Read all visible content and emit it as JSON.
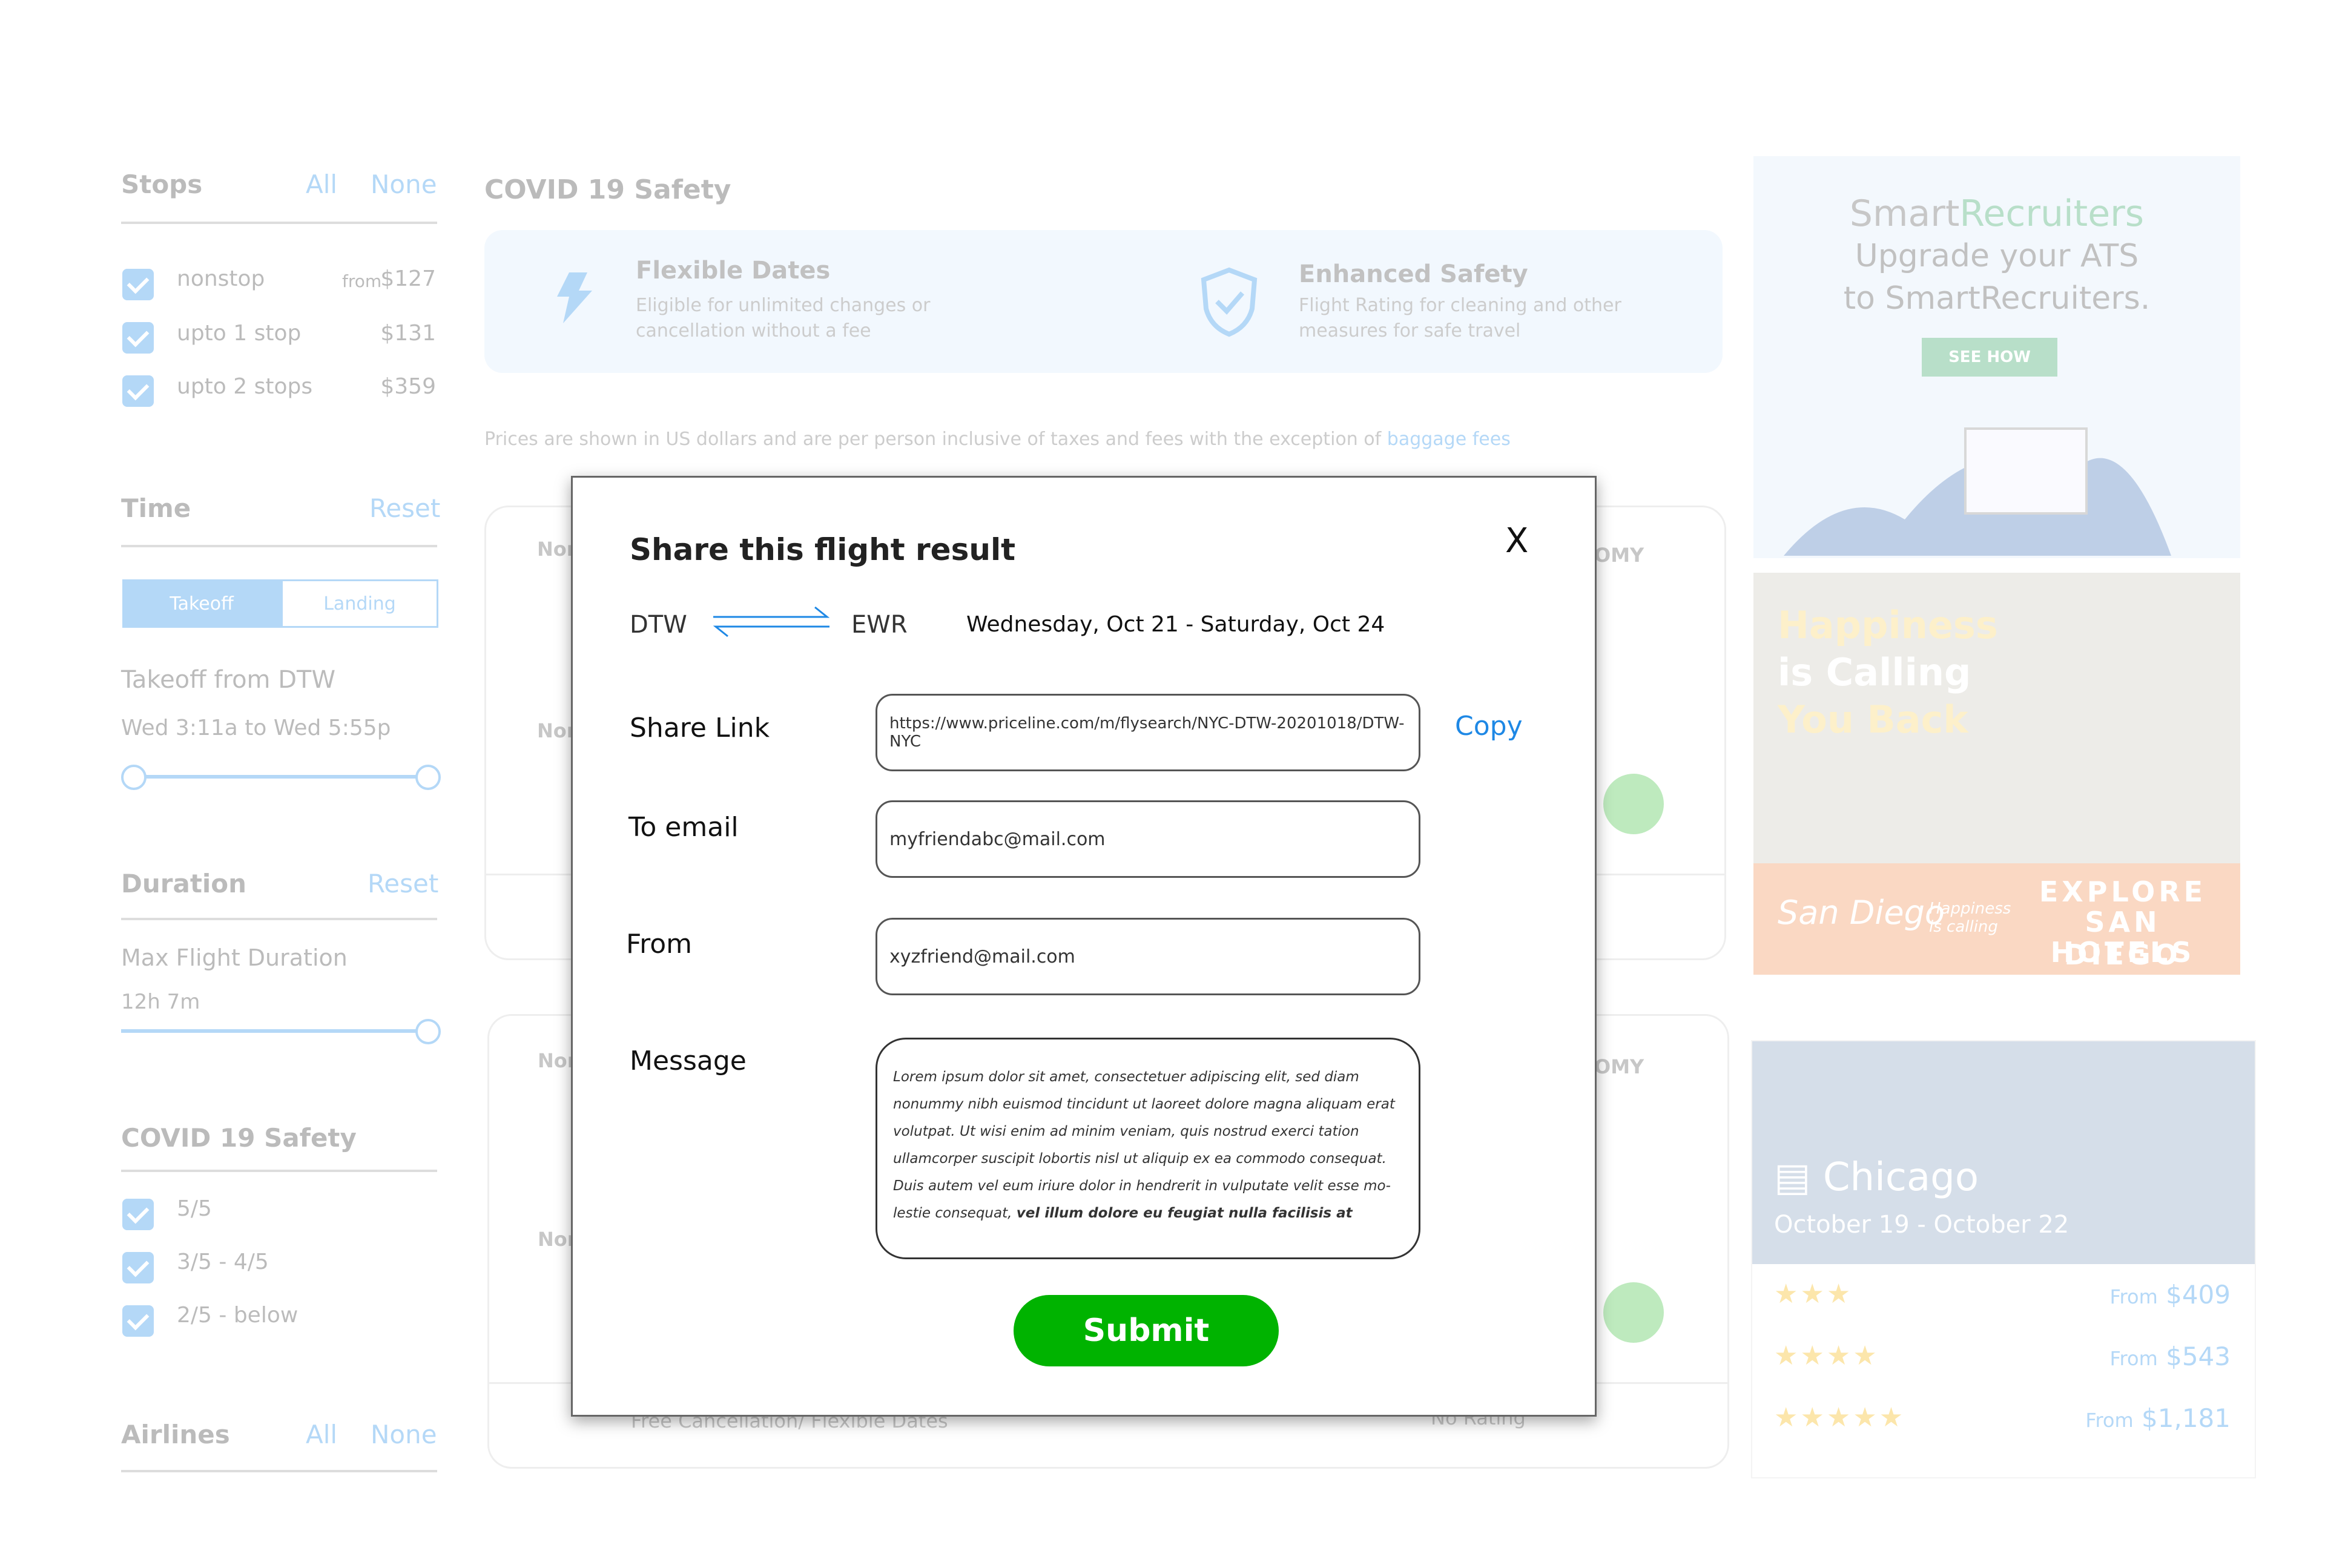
{
  "sidebar": {
    "stops": {
      "title": "Stops",
      "all": "All",
      "none": "None",
      "options": [
        {
          "label": "nonstop",
          "from": "from",
          "price": "$127"
        },
        {
          "label": "upto 1 stop",
          "from": "",
          "price": "$131"
        },
        {
          "label": "upto 2 stops",
          "from": "",
          "price": "$359"
        }
      ]
    },
    "time": {
      "title": "Time",
      "reset": "Reset",
      "tab_takeoff": "Takeoff",
      "tab_landing": "Landing",
      "subtitle": "Takeoff from DTW",
      "range": "Wed 3:11a to Wed 5:55p"
    },
    "duration": {
      "title": "Duration",
      "reset": "Reset",
      "subtitle": "Max Flight Duration",
      "value": "12h 7m"
    },
    "covid": {
      "title": "COVID 19 Safety",
      "options": [
        "5/5",
        "3/5 - 4/5",
        "2/5 - below"
      ]
    },
    "airlines": {
      "title": "Airlines",
      "all": "All",
      "none": "None"
    }
  },
  "main": {
    "covid_heading": "COVID 19  Safety",
    "features": [
      {
        "title": "Flexible Dates",
        "desc": "Eligible for unlimited changes or cancellation without a fee"
      },
      {
        "title": "Enhanced Safety",
        "desc": "Flight Rating for cleaning and other measures for safe travel"
      }
    ],
    "disclaimer": "Prices are shown in US dollars and are per person inclusive of taxes and fees with the exception of",
    "disclaimer_link": "baggage fees",
    "card_fragments": {
      "non1": "Nor",
      "non2": "Nor",
      "non3": "Nor",
      "non4": "Nor",
      "omy1": "OMY",
      "omy2": "OMY",
      "free_cancel": "Free Cancellation/ Flexible Dates",
      "no_rating": "No Rating"
    }
  },
  "modal": {
    "title": "Share this flight result",
    "close": "X",
    "from_code": "DTW",
    "to_code": "EWR",
    "dates": "Wednesday, Oct 21 - Saturday, Oct 24",
    "share_link_label": "Share Link",
    "share_link_value": "https://www.priceline.com/m/flysearch/NYC-DTW-20201018/DTW-NYC",
    "copy": "Copy",
    "to_email_label": "To email",
    "to_email_value": "myfriendabc@mail.com",
    "from_label": "From",
    "from_value": "xyzfriend@mail.com",
    "message_label": "Message",
    "message_text": "Lorem ipsum dolor sit amet, consectetuer adipiscing elit, sed diam nonummy nibh euismod tincidunt ut laoreet dolore magna aliquam erat volutpat. Ut wisi enim ad minim veniam, quis nostrud exerci tation ullamcorper suscipit lobortis nisl ut aliquip ex ea commodo consequat. Duis autem vel eum iriure dolor in hendrerit in vulputate velit esse mo-lestie consequat,",
    "message_bold": "vel illum dolore eu feugiat nulla facilisis at",
    "submit": "Submit",
    "submit_color": "#00b300"
  },
  "ads": {
    "ad1": {
      "brand_a": "Smart",
      "brand_b": "Recruiters",
      "line1": "Upgrade your ATS",
      "line2": "to SmartRecruiters.",
      "cta": "SEE HOW"
    },
    "ad2": {
      "line1": "Happiness",
      "line2": "is Calling",
      "line3": "You Back",
      "logo": "San Diego",
      "tagline": "Happiness is calling",
      "cta1": "EXPLORE",
      "cta2": "SAN DIEGO",
      "cta3": "HOTELS"
    },
    "ad3": {
      "city": "Chicago",
      "dates": "October 19 - October 22",
      "rows": [
        {
          "stars": "★★★",
          "from": "From",
          "price": "$409"
        },
        {
          "stars": "★★★★",
          "from": "From",
          "price": "$543"
        },
        {
          "stars": "★★★★★",
          "from": "From",
          "price": "$1,181"
        }
      ]
    }
  },
  "colors": {
    "accent": "#1e88e5",
    "submit": "#00b300"
  }
}
